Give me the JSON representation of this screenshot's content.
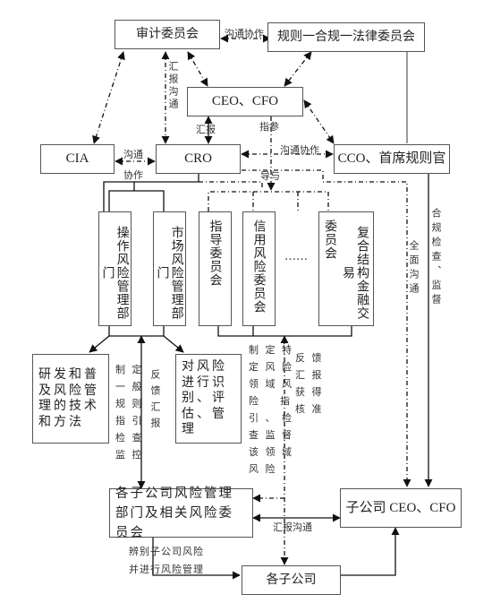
{
  "nodes": {
    "audit_committee": "审计委员会",
    "rules_legal_committee": "规则一合规一法律委员会",
    "ceo_cfo": "CEO、CFO",
    "cia": "CIA",
    "cro": "CRO",
    "cco": "CCO、首席规则官",
    "op_risk_dept": "操作风险管理部门",
    "market_risk_dept": "市场风险管理部门",
    "guidance_committee": "指导委员会",
    "credit_risk_committee": "信用风险委员会",
    "ellipsis": "……",
    "complex_structure_committee_col1": "复合结构金融交易",
    "complex_structure_committee_col2": "委员会",
    "research_methods": "研发和普及风险管理的技术和方法",
    "identify_assess": "对风险进行识别、评估、管理",
    "sub_risk_dept": "各子公司风险管理部门及相关风险委员会",
    "sub_ceo_cfo": "子公司 CEO、CFO",
    "subsidiaries": "各子公司"
  },
  "edge_labels": {
    "audit_rules_comm": "沟通协作",
    "audit_cro_report": "汇报沟通",
    "ceo_cro_report": "汇报",
    "ceo_guide": "指参",
    "cro_cco_comm": "沟通协作",
    "cia_cro_comm_1": "沟通",
    "cia_cro_comm_2": "协作",
    "guide_with": "导与",
    "full_comm": "全面沟通",
    "compliance_check": "合规检查、监督",
    "general_rules": "制 定\n一 般\n规 则\n指 引\n检 查\n监 控",
    "feedback_report_left": "反馈汇报",
    "specific_rules": "制 定 特\n定 风 险\n领 域 风\n险    指\n引 、 检\n查 监 督\n该 领 域\n风 险",
    "feedback_approval": "反 馈\n汇 报\n获 得\n核 准",
    "report_comm_bottom": "汇报沟通",
    "identify_sub_risk": "辨别子公司风险\n并进行风险管理"
  },
  "colors": {
    "line": "#111111",
    "box_border": "#555555"
  }
}
